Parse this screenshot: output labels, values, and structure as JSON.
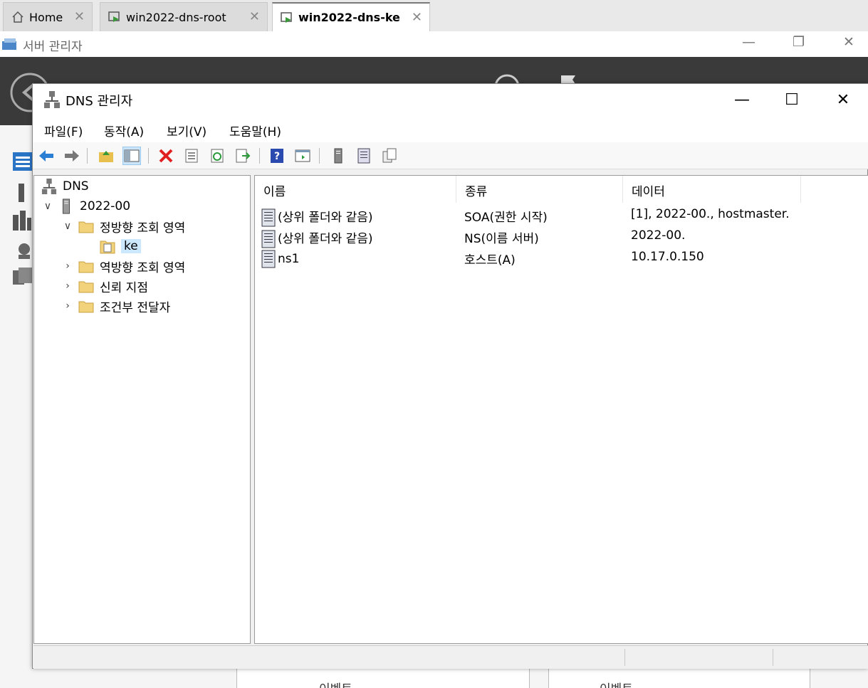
{
  "host_tabs": [
    {
      "label": "Home",
      "close": "✕"
    },
    {
      "label": "win2022-dns-root",
      "close": "✕"
    },
    {
      "label": "win2022-dns-ke",
      "close": "✕"
    }
  ],
  "server_manager": {
    "title": "서버 관리자",
    "bottom_tiles": [
      "이벤트",
      "이벤트"
    ]
  },
  "dns_window": {
    "title": "DNS 관리자",
    "controls": {
      "minimize": "—",
      "maximize": "☐",
      "close": "✕"
    }
  },
  "menu": [
    "파일(F)",
    "동작(A)",
    "보기(V)",
    "도움말(H)"
  ],
  "toolbar_icons": [
    "back-arrow-icon",
    "forward-arrow-icon",
    "up-folder-icon",
    "show-hide-tree-icon",
    "delete-icon",
    "properties-icon",
    "refresh-icon",
    "export-list-icon",
    "help-icon",
    "show-pane-icon",
    "server-icon",
    "record-list-icon",
    "copy-icon"
  ],
  "tree": {
    "root": "DNS",
    "server": "2022-00",
    "forward_zones": "정방향 조회 영역",
    "selected_zone": "ke",
    "reverse_zones": "역방향 조회 영역",
    "trust_points": "신뢰 지점",
    "conditional_forwarders": "조건부 전달자"
  },
  "list": {
    "columns": [
      "이름",
      "종류",
      "데이터"
    ],
    "rows": [
      {
        "name": "(상위 폴더와 같음)",
        "type": "SOA(권한 시작)",
        "data": "[1], 2022-00., hostmaster."
      },
      {
        "name": "(상위 폴더와 같음)",
        "type": "NS(이름 서버)",
        "data": "2022-00."
      },
      {
        "name": "ns1",
        "type": "호스트(A)",
        "data": "10.17.0.150"
      }
    ]
  },
  "colors": {
    "selection": "#cce8ff",
    "dark_header": "#3a3a3a",
    "delete_red": "#e02020",
    "back_blue": "#2a7fd4"
  }
}
